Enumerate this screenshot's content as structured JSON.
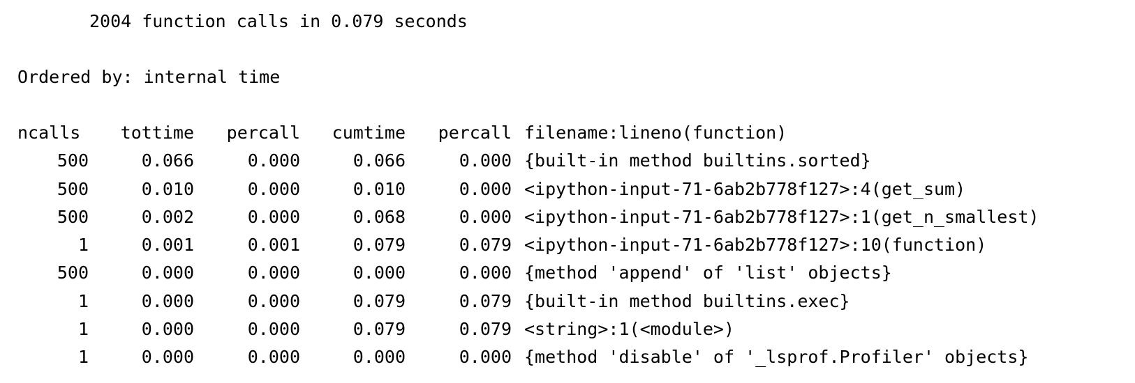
{
  "summary": "2004 function calls in 0.079 seconds",
  "ordered_by": "Ordered by: internal time",
  "table": {
    "headers": [
      "ncalls",
      "tottime",
      "percall",
      "cumtime",
      "percall",
      "filename:lineno(function)"
    ],
    "rows": [
      [
        "500",
        "0.066",
        "0.000",
        "0.066",
        "0.000",
        "{built-in method builtins.sorted}"
      ],
      [
        "500",
        "0.010",
        "0.000",
        "0.010",
        "0.000",
        "<ipython-input-71-6ab2b778f127>:4(get_sum)"
      ],
      [
        "500",
        "0.002",
        "0.000",
        "0.068",
        "0.000",
        "<ipython-input-71-6ab2b778f127>:1(get_n_smallest)"
      ],
      [
        "1",
        "0.001",
        "0.001",
        "0.079",
        "0.079",
        "<ipython-input-71-6ab2b778f127>:10(function)"
      ],
      [
        "500",
        "0.000",
        "0.000",
        "0.000",
        "0.000",
        "{method 'append' of 'list' objects}"
      ],
      [
        "1",
        "0.000",
        "0.000",
        "0.079",
        "0.079",
        "{built-in method builtins.exec}"
      ],
      [
        "1",
        "0.000",
        "0.000",
        "0.079",
        "0.079",
        "<string>:1(<module>)"
      ],
      [
        "1",
        "0.000",
        "0.000",
        "0.000",
        "0.000",
        "{method 'disable' of '_lsprof.Profiler' objects}"
      ]
    ]
  }
}
